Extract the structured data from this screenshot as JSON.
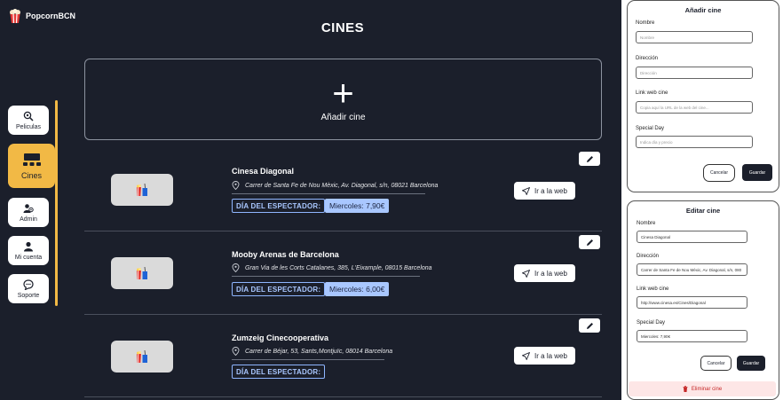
{
  "brand": {
    "name": "PopcornBCN"
  },
  "page": {
    "title": "CINES"
  },
  "sidebar": {
    "items": [
      {
        "label": "Peliculas",
        "icon": "film-search-icon"
      },
      {
        "label": "Cines",
        "icon": "cinema-seats-icon"
      },
      {
        "label": "Admin",
        "icon": "admin-users-icon"
      },
      {
        "label": "Mi cuenta",
        "icon": "user-icon"
      },
      {
        "label": "Soporte",
        "icon": "support-chat-icon"
      }
    ]
  },
  "add_card": {
    "plus": "+",
    "label": "Añadir cine"
  },
  "cinemas": [
    {
      "name": "Cinesa Diagonal",
      "address": "Carrer de Santa Fe de Nou Mèxic, Av. Diagonal, s/n, 08021 Barcelona",
      "spectator_label": "DÍA DEL ESPECTADOR:",
      "spectator_price": "Miercoles: 7,90€",
      "web_label": "Ir a la web"
    },
    {
      "name": "Mooby Arenas de Barcelona",
      "address": "Gran Via de les Corts Catalanes, 385, L'Eixample, 08015 Barcelona",
      "spectator_label": "DÍA DEL ESPECTADOR:",
      "spectator_price": "Miercoles: 6,00€",
      "web_label": "Ir a la web"
    },
    {
      "name": "Zumzeig Cinecooperativa",
      "address": "Carrer de Béjar, 53, Sants,Montjuïc, 08014 Barcelona",
      "spectator_label": "DÍA DEL ESPECTADOR:",
      "spectator_price": "",
      "web_label": "Ir a la web"
    }
  ],
  "add_form": {
    "title": "Añadir cine",
    "name_label": "Nombre",
    "name_placeholder": "Nombre",
    "address_label": "Dirección",
    "address_placeholder": "Dirección",
    "link_label": "Link web cine",
    "link_placeholder": "Copia aquí la URL de la web del cine...",
    "special_label": "Special Day",
    "special_placeholder": "Indica día y precio",
    "cancel_label": "Cancelar",
    "save_label": "Guardar"
  },
  "edit_form": {
    "title": "Editar cine",
    "name_label": "Nombre",
    "name_value": "Cinesa Diagonal",
    "address_label": "Dirección",
    "address_value": "Carrer de Santa Fe de Nou Mèxic, Av. Diagonal, s/n, 080",
    "link_label": "Link web cine",
    "link_value": "http://www.cinesa.es/Cines/Diagonal",
    "special_label": "Special Day",
    "special_value": "Miercoles: 7,90€",
    "cancel_label": "Cancelar",
    "save_label": "Guardar",
    "delete_label": "Eliminar cine"
  },
  "colors": {
    "background": "#1b1f2b",
    "accent": "#f2b945",
    "spectator": "#a9c7ff",
    "danger": "#c62828"
  }
}
